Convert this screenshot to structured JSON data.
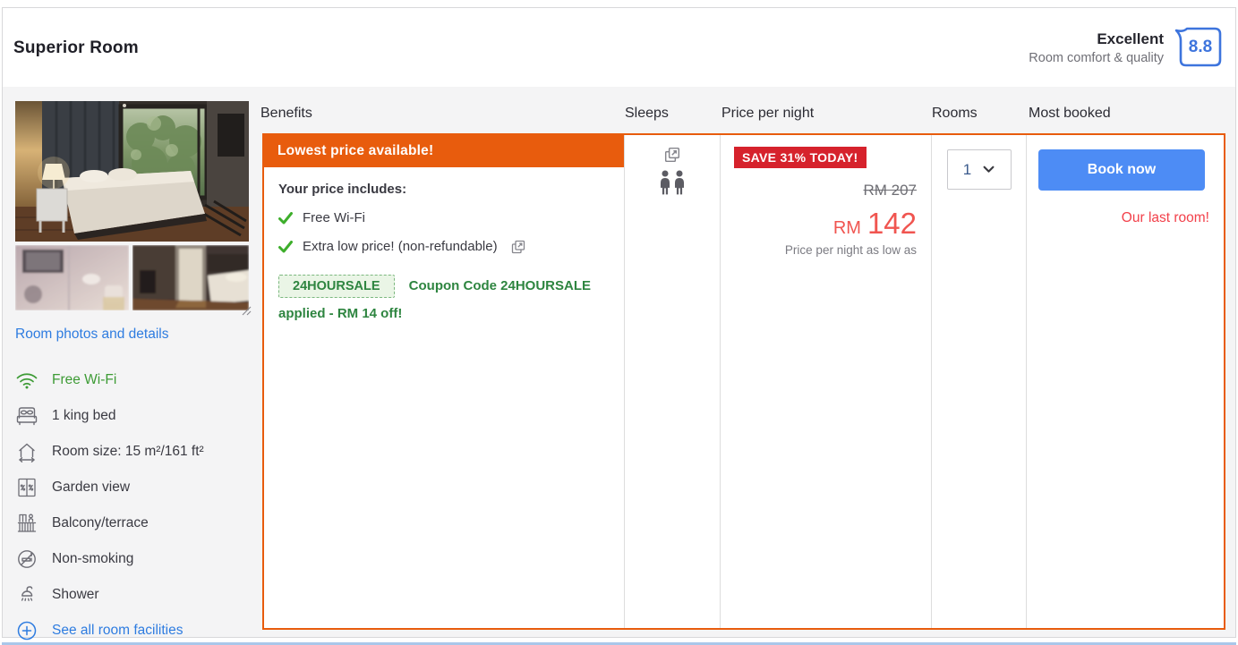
{
  "header": {
    "room_name": "Superior Room",
    "rating_label": "Excellent",
    "rating_sublabel": "Room comfort & quality",
    "rating_score": "8.8"
  },
  "photos": {
    "link_label": "Room photos and details"
  },
  "amenities": [
    {
      "icon": "wifi-icon",
      "label": "Free Wi-Fi"
    },
    {
      "icon": "bed-icon",
      "label": "1 king bed"
    },
    {
      "icon": "room-size-icon",
      "label": "Room size: 15 m²/161 ft²"
    },
    {
      "icon": "garden-view-icon",
      "label": "Garden view"
    },
    {
      "icon": "balcony-icon",
      "label": "Balcony/terrace"
    },
    {
      "icon": "no-smoking-icon",
      "label": "Non-smoking"
    },
    {
      "icon": "shower-icon",
      "label": "Shower"
    },
    {
      "icon": "plus-circle-icon",
      "label": "See all room facilities"
    }
  ],
  "table": {
    "headers": [
      "Benefits",
      "Sleeps",
      "Price per night",
      "Rooms",
      "Most booked"
    ]
  },
  "offer": {
    "banner": "Lowest price available!",
    "includes_title": "Your price includes:",
    "includes": [
      "Free Wi-Fi",
      "Extra low price! (non-refundable)"
    ],
    "coupon_tag": "24HOURSALE",
    "coupon_text": "Coupon Code 24HOURSALE applied - RM 14 off!",
    "sleeps_occupancy": 2,
    "save_badge": "SAVE 31% TODAY!",
    "old_price": "RM 207",
    "currency": "RM",
    "price": "142",
    "price_note": "Price per night as low as",
    "rooms_value": "1",
    "book_label": "Book now",
    "urgency": "Our last room!"
  },
  "colors": {
    "accent_orange": "#e85c0d",
    "badge_red": "#d6222c",
    "price_red": "#f05550",
    "button_blue": "#4d8cf5",
    "link_blue": "#2e7ce0",
    "coupon_green": "#2e8540",
    "check_green": "#3dae2b",
    "rating_blue": "#3d74dd"
  }
}
